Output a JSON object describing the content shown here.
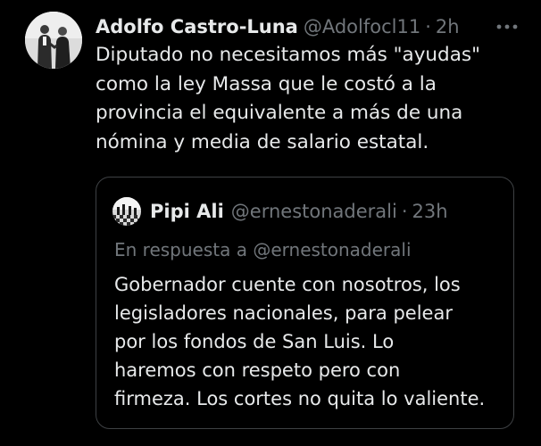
{
  "tweet": {
    "display_name": "Adolfo Castro-Luna",
    "handle": "@Adolfocl11",
    "separator": "·",
    "time": "2h",
    "text": "Diputado no necesitamos más \"ayudas\"\ncomo la ley Massa que le costó a la\nprovincia el equivalente a más de una\nnómina y media de salario estatal.",
    "more_icon": "more-horizontal-icon"
  },
  "quote": {
    "display_name": "Pipi Ali",
    "handle": "@ernestonaderali",
    "separator": "·",
    "time": "23h",
    "reply_to": "En respuesta a @ernestonaderali",
    "text": "Gobernador cuente con nosotros, los\nlegisladores nacionales, para pelear\npor los fondos de San Luis. Lo\nharemos con respeto pero con\nfirmeza. Los cortes no quita lo valiente."
  },
  "colors": {
    "background": "#000000",
    "primary_text": "#e7e9ea",
    "secondary_text": "#71767b",
    "border": "#3e4144"
  }
}
